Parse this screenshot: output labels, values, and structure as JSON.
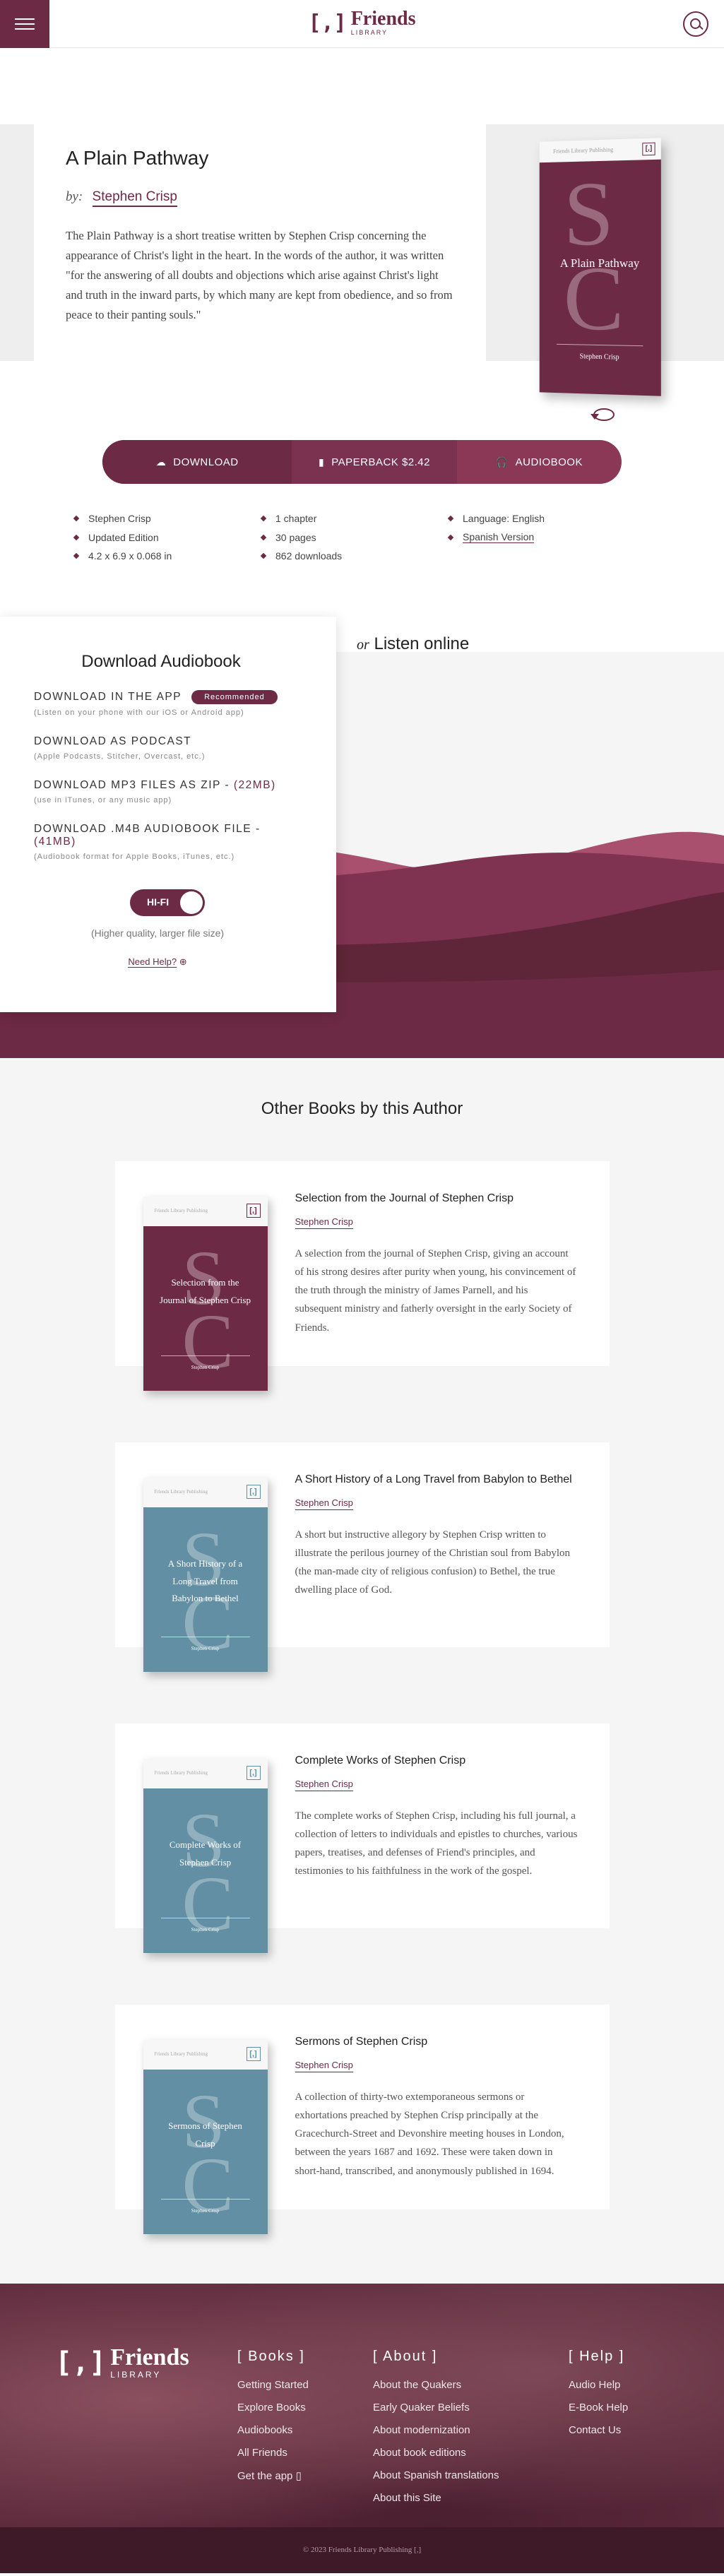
{
  "nav": {
    "logo_bracket": "[,]",
    "logo_word": "Friends",
    "logo_sub": "LIBRARY"
  },
  "book": {
    "title": "A Plain Pathway",
    "by_label": "by:",
    "author": "Stephen Crisp",
    "description": "The Plain Pathway is a short treatise written by Stephen Crisp concerning the appearance of Christ's light in the heart. In the words of the author, it was written \"for the answering of all doubts and objections which arise against Christ's light and truth in the inward parts, by which many are kept from obedience, and so from peace to their panting souls.\"",
    "cover": {
      "publisher": "Friends Library Publishing",
      "mark": "[,]",
      "title": "A Plain Pathway",
      "author": "Stephen Crisp",
      "color": "#6c2a44"
    }
  },
  "actions": {
    "download": "DOWNLOAD",
    "paperback": "PAPERBACK $2.42",
    "audiobook": "AUDIOBOOK"
  },
  "meta": {
    "col1": [
      "Stephen Crisp",
      "Updated Edition",
      "4.2 x 6.9 x 0.068 in"
    ],
    "col2": [
      "1 chapter",
      "30 pages",
      "862 downloads"
    ],
    "col3": [
      "Language: English",
      "Spanish Version"
    ]
  },
  "audio": {
    "heading": "Download Audiobook",
    "options": [
      {
        "title": "DOWNLOAD IN THE APP",
        "badge": "Recommended",
        "sub": "(Listen on your phone with our iOS or Android app)"
      },
      {
        "title": "DOWNLOAD AS PODCAST",
        "sub": "(Apple Podcasts, Stitcher, Overcast, etc.)"
      },
      {
        "title": "DOWNLOAD MP3 FILES AS ZIP -",
        "size": "(22MB)",
        "sub": "(use in iTunes, or any music app)"
      },
      {
        "title": "DOWNLOAD .M4B AUDIOBOOK FILE -",
        "size": "(41MB)",
        "sub": "(Audiobook format for Apple Books, iTunes, etc.)"
      }
    ],
    "hifi_label": "HI-FI",
    "hifi_note": "(Higher quality, larger file size)",
    "help": "Need Help?",
    "listen_or": "or",
    "listen_online": "Listen online"
  },
  "others": {
    "heading": "Other Books by this Author",
    "books": [
      {
        "title": "Selection from the Journal of Stephen Crisp",
        "author": "Stephen Crisp",
        "desc": "A selection from the journal of Stephen Crisp, giving an account of his strong desires after purity when young, his convincement of the truth through the ministry of James Parnell, and his subsequent ministry and fatherly oversight in the early Society of Friends.",
        "cover_title": "Selection from the Journal of Stephen Crisp",
        "color": "#6c2a44",
        "mark_color": "#6c2a44"
      },
      {
        "title": "A Short History of a Long Travel from Babylon to Bethel",
        "author": "Stephen Crisp",
        "desc": "A short but instructive allegory by Stephen Crisp written to illustrate the perilous journey of the Christian soul from Babylon (the man-made city of religious confusion) to Bethel, the true dwelling place of God.",
        "cover_title": "A Short History of a Long Travel from Babylon to Bethel",
        "color": "#628fa3",
        "mark_color": "#628fa3"
      },
      {
        "title": "Complete Works of Stephen Crisp",
        "author": "Stephen Crisp",
        "desc": "The complete works of Stephen Crisp, including his full journal, a collection of letters to individuals and epistles to churches, various papers, treatises, and defenses of Friend's principles, and testimonies to his faithfulness in the work of the gospel.",
        "cover_title": "Complete Works of Stephen Crisp",
        "color": "#628fa3",
        "mark_color": "#628fa3"
      },
      {
        "title": "Sermons of Stephen Crisp",
        "author": "Stephen Crisp",
        "desc": "A collection of thirty-two extemporaneous sermons or exhortations preached by Stephen Crisp principally at the Gracechurch-Street and Devonshire meeting houses in London, between the years 1687 and 1692. These were taken down in short-hand, transcribed, and anonymously published in 1694.",
        "cover_title": "Sermons of Stephen Crisp",
        "color": "#628fa3",
        "mark_color": "#628fa3"
      }
    ],
    "cover_publisher": "Friends Library Publishing",
    "cover_mark": "[,]"
  },
  "footer": {
    "logo_bracket": "[,]",
    "logo_word": "Friends",
    "logo_sub": "LIBRARY",
    "books_head": "[ Books ]",
    "books_links": [
      "Getting Started",
      "Explore Books",
      "Audiobooks",
      "All Friends",
      "Get the app"
    ],
    "about_head": "[ About ]",
    "about_links": [
      "About the Quakers",
      "Early Quaker Beliefs",
      "About modernization",
      "About book editions",
      "About Spanish translations",
      "About this Site"
    ],
    "help_head": "[ Help ]",
    "help_links": [
      "Audio Help",
      "E-Book Help",
      "Contact Us"
    ],
    "copyright": "© 2023 Friends Library Publishing [,]"
  }
}
